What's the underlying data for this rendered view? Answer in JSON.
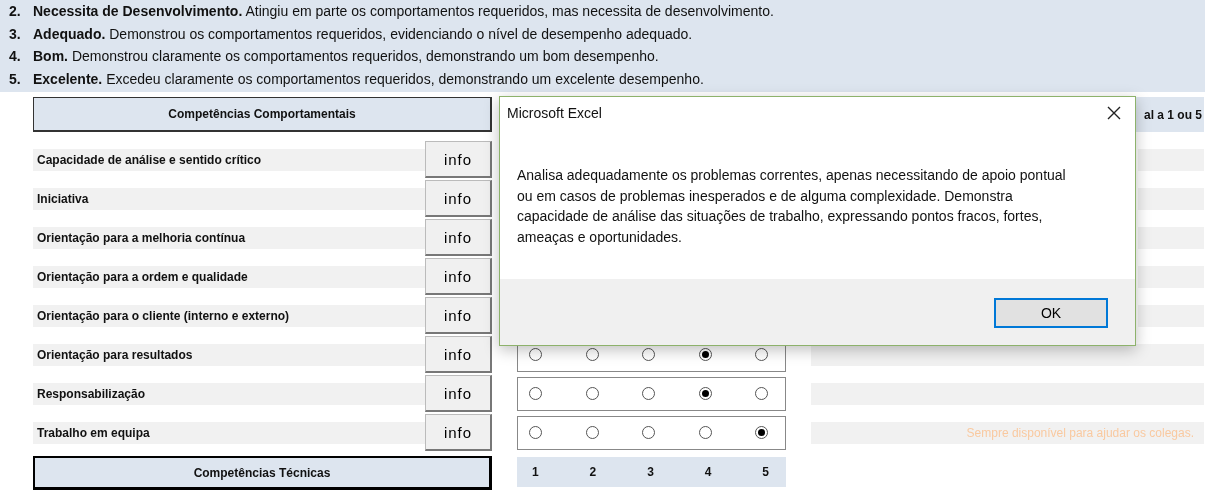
{
  "scale_legend": [
    {
      "number": "2.",
      "text": "**Necessita de Desenvolvimento.** Atingiu em parte os comportamentos requeridos, mas necessita de desenvolvimento."
    },
    {
      "number": "3.",
      "text": "**Adequado.** Demonstrou os comportamentos requeridos, evidenciando o nível de desempenho adequado."
    },
    {
      "number": "4.",
      "text": "**Bom.** Demonstrou claramente os comportamentos requeridos, demonstrando um bom desempenho."
    },
    {
      "number": "5.",
      "text": "**Excelente.** Excedeu claramente os comportamentos requeridos, demonstrando um excelente desempenho."
    }
  ],
  "behavioral": {
    "title": "Competências Comportamentais",
    "comment_header": "al a 1 ou 5",
    "rows": [
      {
        "name": "Capacidade de análise e sentido crítico",
        "button": "info"
      },
      {
        "name": "Iniciativa",
        "button": "info"
      },
      {
        "name": "Orientação para a melhoria contínua",
        "button": "info"
      },
      {
        "name": "Orientação para a ordem e qualidade",
        "button": "info"
      },
      {
        "name": "Orientação para o cliente (interno e externo)",
        "button": "info"
      },
      {
        "name": "Orientação para resultados",
        "button": "info",
        "options": [
          {
            "selected": false
          },
          {
            "selected": false
          },
          {
            "selected": false
          },
          {
            "selected": true
          },
          {
            "selected": false
          }
        ]
      },
      {
        "name": "Responsabilização",
        "button": "info",
        "options": [
          {
            "selected": false
          },
          {
            "selected": false
          },
          {
            "selected": false
          },
          {
            "selected": true
          },
          {
            "selected": false
          }
        ]
      },
      {
        "name": "Trabalho em equipa",
        "button": "info",
        "options": [
          {
            "selected": false
          },
          {
            "selected": false
          },
          {
            "selected": false
          },
          {
            "selected": false
          },
          {
            "selected": true
          }
        ],
        "comment": "Sempre disponível para ajudar os colegas."
      }
    ]
  },
  "technical": {
    "title": "Competências Técnicas",
    "scale": [
      "1",
      "2",
      "3",
      "4",
      "5"
    ]
  },
  "dialog": {
    "title": "Microsoft Excel",
    "message": "Analisa adequadamente os problemas correntes, apenas necessitando de apoio pontual ou em casos de problemas inesperados e de alguma complexidade. Demonstra capacidade de análise das situações de trabalho, expressando pontos fracos, fortes, ameaças e oportunidades.",
    "button": "OK"
  }
}
